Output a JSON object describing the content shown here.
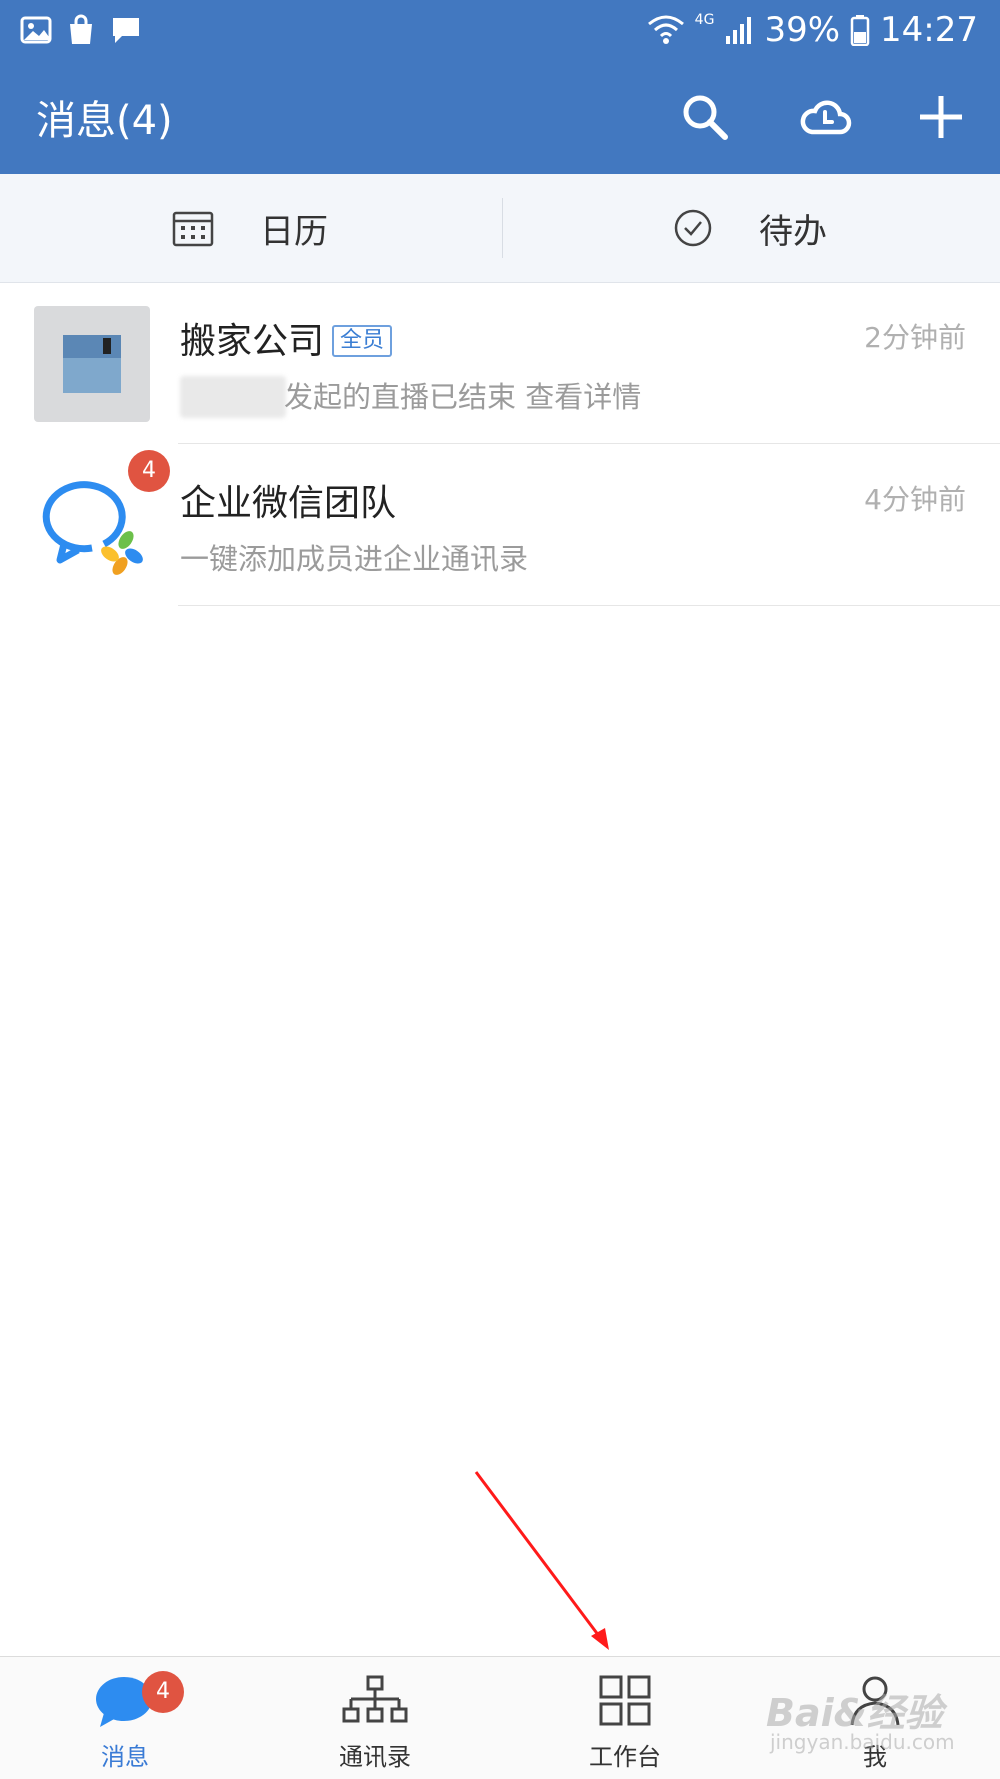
{
  "status_bar": {
    "battery": "39%",
    "time": "14:27",
    "network": "4G",
    "left_icons": [
      "image-icon",
      "shopping-bag-icon",
      "message-icon"
    ],
    "right_icons": [
      "wifi-icon",
      "signal-icon",
      "battery-icon"
    ]
  },
  "header": {
    "title": "消息(4)",
    "actions": [
      "search-icon",
      "cloud-icon",
      "plus-icon"
    ]
  },
  "quick_bar": {
    "calendar_label": "日历",
    "todo_label": "待办"
  },
  "chats": [
    {
      "name": "搬家公司",
      "tag": "全员",
      "preview": "发起的直播已结束 查看详情",
      "time": "2分钟前"
    },
    {
      "name": "企业微信团队",
      "preview": "一键添加成员进企业通讯录",
      "time": "4分钟前",
      "unread": "4"
    }
  ],
  "tabs": [
    {
      "label": "消息",
      "badge": "4",
      "active": true
    },
    {
      "label": "通讯录"
    },
    {
      "label": "工作台"
    },
    {
      "label": "我"
    }
  ],
  "watermark": {
    "main": "Bai&经验",
    "sub": "jingyan.baidu.com"
  },
  "colors": {
    "brand_blue": "#4278c0",
    "badge_red": "#e05441",
    "arrow_red": "#ff1a1a"
  }
}
